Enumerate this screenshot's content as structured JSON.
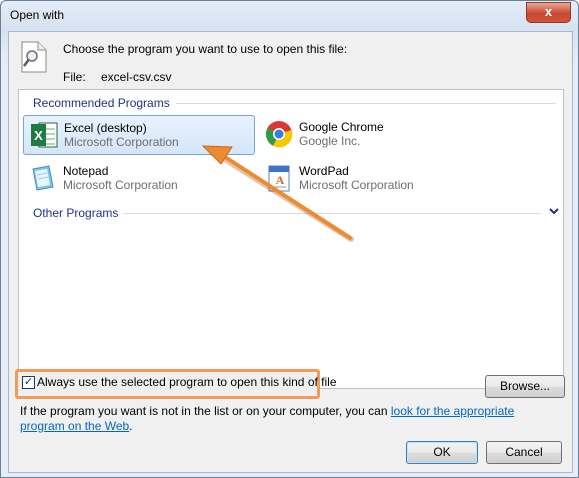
{
  "window": {
    "title": "Open with",
    "close_glyph": "x"
  },
  "header": {
    "prompt": "Choose the program you want to use to open this file:",
    "file_label": "File:",
    "file_name": "excel-csv.csv"
  },
  "recommended": {
    "heading": "Recommended Programs",
    "programs": [
      {
        "name": "Excel (desktop)",
        "publisher": "Microsoft Corporation",
        "icon": "excel-icon",
        "selected": true
      },
      {
        "name": "Google Chrome",
        "publisher": "Google Inc.",
        "icon": "chrome-icon"
      },
      {
        "name": "Notepad",
        "publisher": "Microsoft Corporation",
        "icon": "notepad-icon"
      },
      {
        "name": "WordPad",
        "publisher": "Microsoft Corporation",
        "icon": "wordpad-icon"
      }
    ]
  },
  "other": {
    "heading": "Other Programs"
  },
  "always_checkbox": {
    "label": "Always use the selected program to open this kind of file",
    "checked": true
  },
  "buttons": {
    "browse": "Browse...",
    "ok": "OK",
    "cancel": "Cancel"
  },
  "info": {
    "text": "If the program you want is not in the list or on your computer, you can ",
    "link": "look for the appropriate program on the Web",
    "end": "."
  },
  "colors": {
    "highlight": "#f39c5a",
    "link": "#0066cc",
    "group_heading": "#1e3287"
  }
}
